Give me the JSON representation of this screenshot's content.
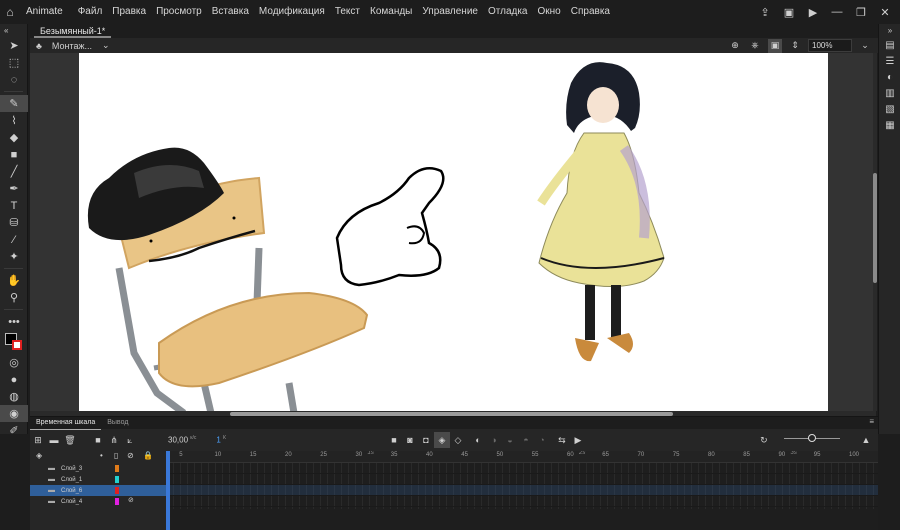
{
  "app": {
    "name": "Animate",
    "menu": [
      "Файл",
      "Правка",
      "Просмотр",
      "Вставка",
      "Модификация",
      "Текст",
      "Команды",
      "Управление",
      "Отладка",
      "Окно",
      "Справка"
    ]
  },
  "document": {
    "tab_title": "Безымянный-1*",
    "scene_label": "Монтаж...",
    "zoom": "100%"
  },
  "timeline": {
    "tabs": [
      "Временная шкала",
      "Вывод"
    ],
    "fps_value": "30,00",
    "fps_unit": "к/с",
    "current_frame": "1",
    "frame_unit": "К",
    "ruler_ticks": [
      "5",
      "10",
      "15",
      "20",
      "25",
      "30",
      "35",
      "40",
      "45",
      "50",
      "55",
      "60",
      "65",
      "70",
      "75",
      "80",
      "85",
      "90",
      "95",
      "100"
    ],
    "ruler_seconds": [
      "1s",
      "2s",
      "3s"
    ],
    "layers": [
      {
        "name": "Слой_3",
        "color": "#e07b1a",
        "selected": false,
        "hidden": false
      },
      {
        "name": "Слой_1",
        "color": "#22d0d0",
        "selected": false,
        "hidden": false
      },
      {
        "name": "Слой_6",
        "color": "#e02020",
        "selected": true,
        "hidden": false
      },
      {
        "name": "Слой_4",
        "color": "#e020e0",
        "selected": false,
        "hidden": true
      }
    ]
  },
  "colors": {
    "accent": "#3a78d8",
    "selection": "#2f5f9a",
    "stroke_swatch": "#000000",
    "fill_swatch": "#ffffff"
  }
}
